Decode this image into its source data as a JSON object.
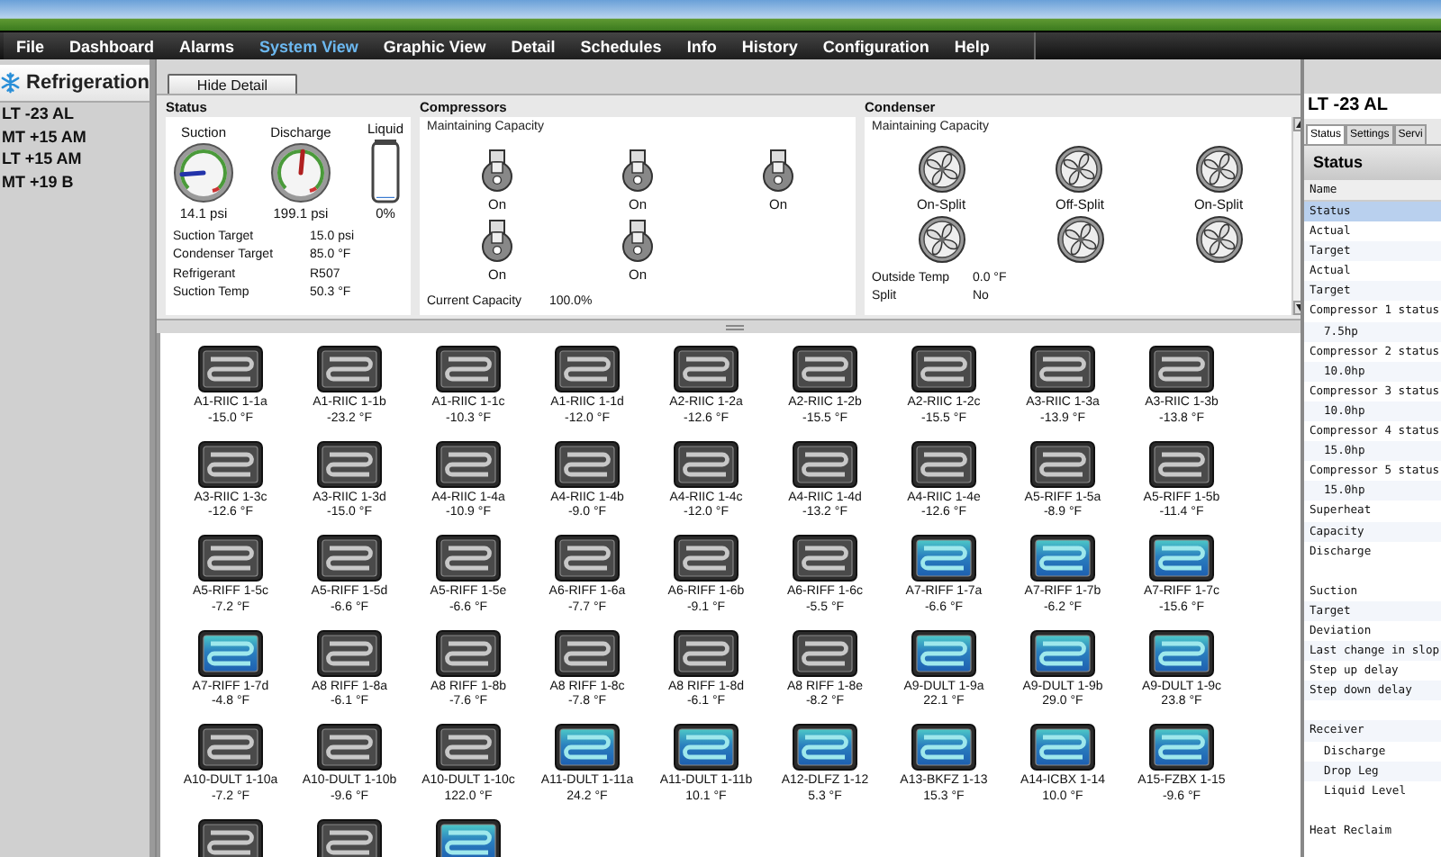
{
  "menu": [
    {
      "label": "File",
      "selected": false
    },
    {
      "label": "Dashboard",
      "selected": false
    },
    {
      "label": "Alarms",
      "selected": false
    },
    {
      "label": "System View",
      "selected": true
    },
    {
      "label": "Graphic View",
      "selected": false
    },
    {
      "label": "Detail",
      "selected": false
    },
    {
      "label": "Schedules",
      "selected": false
    },
    {
      "label": "Info",
      "selected": false
    },
    {
      "label": "History",
      "selected": false
    },
    {
      "label": "Configuration",
      "selected": false
    },
    {
      "label": "Help",
      "selected": false
    }
  ],
  "sidebar": {
    "title": "Refrigeration",
    "items": [
      "LT -23 AL",
      "MT +15 AM",
      "LT +15 AM",
      "MT +19 B"
    ]
  },
  "toolbar": {
    "button": "Hide Detail"
  },
  "status": {
    "title": "Status",
    "gauges": [
      {
        "kind": "dial",
        "label": "Suction",
        "reading": "14.1 psi",
        "level": 0.15
      },
      {
        "kind": "dial",
        "label": "Discharge",
        "reading": "199.1 psi",
        "level": 0.52
      },
      {
        "kind": "tank",
        "label": "Liquid",
        "reading": "0%",
        "level": 0
      }
    ],
    "fields": [
      {
        "name": "Suction Target",
        "value": "15.0 psi"
      },
      {
        "name": "Condenser Target",
        "value": "85.0 °F"
      },
      {
        "name": "Refrigerant",
        "value": "R507"
      },
      {
        "name": "Suction Temp",
        "value": "50.3 °F"
      }
    ]
  },
  "compressors": {
    "title": "Compressors",
    "mode": "Maintaining Capacity",
    "units": [
      {
        "status": "On"
      },
      {
        "status": "On"
      },
      {
        "status": "On"
      },
      {
        "status": "On"
      },
      {
        "status": "On"
      }
    ],
    "fields": [
      {
        "name": "Current Capacity",
        "value": "100.0%"
      }
    ]
  },
  "condenser": {
    "title": "Condenser",
    "mode": "Maintaining Capacity",
    "fans": [
      {
        "kind": "fan",
        "status": "On-Split"
      },
      {
        "kind": "fan",
        "status": "Off-Split"
      },
      {
        "kind": "fan",
        "status": "On-Split"
      },
      {
        "kind": "fan"
      },
      {
        "kind": "fan"
      },
      {
        "kind": "fan"
      }
    ],
    "fields": [
      {
        "name": "Outside Temp",
        "value": "0.0 °F"
      },
      {
        "name": "Split",
        "value": "No"
      }
    ]
  },
  "cases": [
    {
      "name": "A1-RIIC 1-1a",
      "temp": "-15.0 °F",
      "active": false
    },
    {
      "name": "A1-RIIC 1-1b",
      "temp": "-23.2 °F",
      "active": false
    },
    {
      "name": "A1-RIIC 1-1c",
      "temp": "-10.3 °F",
      "active": false
    },
    {
      "name": "A1-RIIC 1-1d",
      "temp": "-12.0 °F",
      "active": false
    },
    {
      "name": "A2-RIIC 1-2a",
      "temp": "-12.6 °F",
      "active": false
    },
    {
      "name": "A2-RIIC 1-2b",
      "temp": "-15.5 °F",
      "active": false
    },
    {
      "name": "A2-RIIC 1-2c",
      "temp": "-15.5 °F",
      "active": false
    },
    {
      "name": "A3-RIIC 1-3a",
      "temp": "-13.9 °F",
      "active": false
    },
    {
      "name": "A3-RIIC 1-3b",
      "temp": "-13.8 °F",
      "active": false
    },
    {
      "name": "A3-RIIC 1-3c",
      "temp": "-12.6 °F",
      "active": false
    },
    {
      "name": "A3-RIIC 1-3d",
      "temp": "-15.0 °F",
      "active": false
    },
    {
      "name": "A4-RIIC 1-4a",
      "temp": "-10.9 °F",
      "active": false
    },
    {
      "name": "A4-RIIC 1-4b",
      "temp": "-9.0 °F",
      "active": false
    },
    {
      "name": "A4-RIIC 1-4c",
      "temp": "-12.0 °F",
      "active": false
    },
    {
      "name": "A4-RIIC 1-4d",
      "temp": "-13.2 °F",
      "active": false
    },
    {
      "name": "A4-RIIC 1-4e",
      "temp": "-12.6 °F",
      "active": false
    },
    {
      "name": "A5-RIFF 1-5a",
      "temp": "-8.9 °F",
      "active": false
    },
    {
      "name": "A5-RIFF 1-5b",
      "temp": "-11.4 °F",
      "active": false
    },
    {
      "name": "A5-RIFF 1-5c",
      "temp": "-7.2 °F",
      "active": false
    },
    {
      "name": "A5-RIFF 1-5d",
      "temp": "-6.6 °F",
      "active": false
    },
    {
      "name": "A5-RIFF 1-5e",
      "temp": "-6.6 °F",
      "active": false
    },
    {
      "name": "A6-RIFF 1-6a",
      "temp": "-7.7 °F",
      "active": false
    },
    {
      "name": "A6-RIFF 1-6b",
      "temp": "-9.1 °F",
      "active": false
    },
    {
      "name": "A6-RIFF 1-6c",
      "temp": "-5.5 °F",
      "active": false
    },
    {
      "name": "A7-RIFF 1-7a",
      "temp": "-6.6 °F",
      "active": true
    },
    {
      "name": "A7-RIFF 1-7b",
      "temp": "-6.2 °F",
      "active": true
    },
    {
      "name": "A7-RIFF 1-7c",
      "temp": "-15.6 °F",
      "active": true
    },
    {
      "name": "A7-RIFF 1-7d",
      "temp": "-4.8 °F",
      "active": true
    },
    {
      "name": "A8 RIFF 1-8a",
      "temp": "-6.1 °F",
      "active": false
    },
    {
      "name": "A8 RIFF 1-8b",
      "temp": "-7.6 °F",
      "active": false
    },
    {
      "name": "A8 RIFF 1-8c",
      "temp": "-7.8 °F",
      "active": false
    },
    {
      "name": "A8 RIFF 1-8d",
      "temp": "-6.1 °F",
      "active": false
    },
    {
      "name": "A8 RIFF 1-8e",
      "temp": "-8.2 °F",
      "active": false
    },
    {
      "name": "A9-DULT 1-9a",
      "temp": "22.1 °F",
      "active": true
    },
    {
      "name": "A9-DULT 1-9b",
      "temp": "29.0 °F",
      "active": true
    },
    {
      "name": "A9-DULT 1-9c",
      "temp": "23.8 °F",
      "active": true
    },
    {
      "name": "A10-DULT 1-10a",
      "temp": "-7.2 °F",
      "active": false
    },
    {
      "name": "A10-DULT 1-10b",
      "temp": "-9.6 °F",
      "active": false
    },
    {
      "name": "A10-DULT 1-10c",
      "temp": "122.0 °F",
      "active": false
    },
    {
      "name": "A11-DULT 1-11a",
      "temp": "24.2 °F",
      "active": true
    },
    {
      "name": "A11-DULT 1-11b",
      "temp": "10.1 °F",
      "active": true
    },
    {
      "name": "A12-DLFZ 1-12",
      "temp": "5.3 °F",
      "active": true
    },
    {
      "name": "A13-BKFZ 1-13",
      "temp": "15.3 °F",
      "active": true
    },
    {
      "name": "A14-ICBX 1-14",
      "temp": "10.0 °F",
      "active": true
    },
    {
      "name": "A15-FZBX 1-15",
      "temp": "-9.6 °F",
      "active": true
    },
    {
      "active": false
    },
    {
      "active": false
    },
    {
      "active": true
    }
  ],
  "properties": {
    "title": "LT -23 AL",
    "tabs": [
      {
        "label": "Status",
        "selected": true
      },
      {
        "label": "Settings",
        "selected": false
      },
      {
        "label": "Servi",
        "selected": false
      }
    ],
    "heading": "Status",
    "column": "Name",
    "groups": [
      [
        {
          "label": "Status",
          "selected": true
        },
        {
          "label": "Actual",
          "selected": false
        },
        {
          "label": "Target",
          "selected": false
        },
        {
          "label": "Actual",
          "selected": false
        },
        {
          "label": "Target",
          "selected": false
        },
        {
          "label": "Compressor 1 status",
          "selected": false,
          "children": [
            {
              "label": "7.5hp",
              "selected": false
            }
          ]
        },
        {
          "label": "Compressor 2 status",
          "selected": false,
          "children": [
            {
              "label": "10.0hp",
              "selected": false
            }
          ]
        },
        {
          "label": "Compressor 3 status",
          "selected": false,
          "children": [
            {
              "label": "10.0hp",
              "selected": false
            }
          ]
        },
        {
          "label": "Compressor 4 status",
          "selected": false,
          "children": [
            {
              "label": "15.0hp",
              "selected": false
            }
          ]
        },
        {
          "label": "Compressor 5 status",
          "selected": false,
          "children": [
            {
              "label": "15.0hp",
              "selected": false
            }
          ]
        },
        {
          "label": "Superheat",
          "selected": false
        },
        {
          "label": "Capacity",
          "selected": false
        },
        {
          "label": "Discharge",
          "selected": false
        }
      ],
      [
        {
          "label": "Suction",
          "selected": false
        },
        {
          "label": "Target",
          "selected": false
        },
        {
          "label": "Deviation",
          "selected": false
        },
        {
          "label": "Last change in slop",
          "selected": false
        },
        {
          "label": "Step up delay",
          "selected": false
        },
        {
          "label": "Step down delay",
          "selected": false
        }
      ],
      [
        {
          "label": "Receiver",
          "selected": false,
          "children": [
            {
              "label": "Discharge",
              "selected": false
            },
            {
              "label": "Drop Leg",
              "selected": false
            },
            {
              "label": "Liquid Level",
              "selected": false
            }
          ]
        }
      ],
      [
        {
          "label": "Heat Reclaim",
          "selected": false
        }
      ]
    ]
  }
}
